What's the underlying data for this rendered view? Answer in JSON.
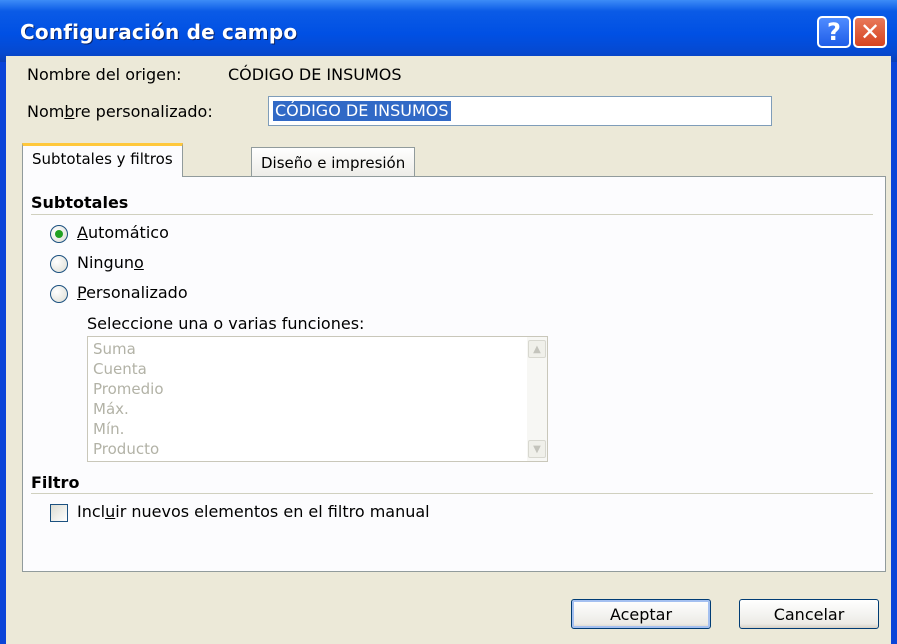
{
  "window": {
    "title": "Configuración de campo",
    "help_icon": "help-icon",
    "help_glyph": "?",
    "close_icon": "close-icon",
    "close_glyph": "✕"
  },
  "form": {
    "origin_label": "Nombre del origen:",
    "origin_value": "CÓDIGO DE INSUMOS",
    "custom_name_label_pre": "Nom",
    "custom_name_label_key": "b",
    "custom_name_label_post": "re personalizado:",
    "custom_name_value": "CÓDIGO DE INSUMOS"
  },
  "tabs": [
    {
      "label": "Subtotales y filtros",
      "active": true
    },
    {
      "label": "Diseño e impresión",
      "active": false
    }
  ],
  "subtotals": {
    "title": "Subtotales",
    "options": [
      {
        "pre": "",
        "key": "A",
        "post": "utomático",
        "selected": true
      },
      {
        "pre": "Ningun",
        "key": "o",
        "post": "",
        "selected": false
      },
      {
        "pre": "",
        "key": "P",
        "post": "ersonalizado",
        "selected": false
      }
    ],
    "functions_label": "Seleccione una o varias funciones:",
    "functions": [
      "Suma",
      "Cuenta",
      "Promedio",
      "Máx.",
      "Mín.",
      "Producto"
    ],
    "scroll_up_glyph": "▲",
    "scroll_down_glyph": "▼"
  },
  "filter": {
    "title": "Filtro",
    "include_pre": "Incl",
    "include_key": "u",
    "include_post": "ir nuevos elementos en el filtro manual",
    "include_checked": false
  },
  "buttons": {
    "accept": "Aceptar",
    "cancel": "Cancelar"
  },
  "colors": {
    "titlebar": "#0050e4",
    "dialog_bg": "#ece9d8",
    "selection": "#3169c6",
    "radio_dot": "#21a121",
    "active_tab_highlight": "#ffc83c"
  }
}
